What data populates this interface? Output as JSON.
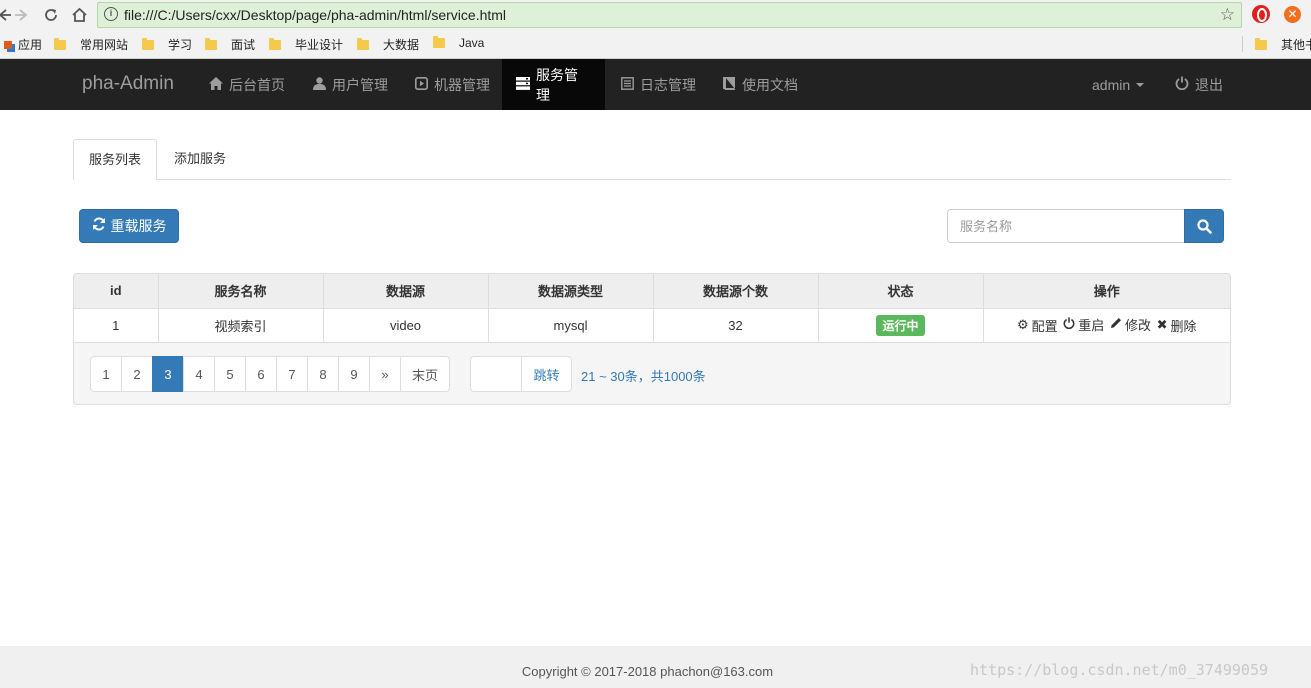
{
  "browser": {
    "url": "file:///C:/Users/cxx/Desktop/page/pha-admin/html/service.html",
    "bookmarks": [
      "应用",
      "常用网站",
      "学习",
      "面试",
      "毕业设计",
      "大数据",
      "Java",
      "其他书"
    ]
  },
  "navbar": {
    "brand": "pha-Admin",
    "items": [
      {
        "label": "后台首页",
        "icon": "home-icon"
      },
      {
        "label": "用户管理",
        "icon": "user-icon"
      },
      {
        "label": "机器管理",
        "icon": "play-square-icon"
      },
      {
        "label": "服务管理",
        "icon": "server-icon",
        "active": true
      },
      {
        "label": "日志管理",
        "icon": "list-alt-icon"
      },
      {
        "label": "使用文档",
        "icon": "book-icon"
      }
    ],
    "user": "admin",
    "logout": "退出"
  },
  "tabs": [
    {
      "label": "服务列表",
      "active": true
    },
    {
      "label": "添加服务",
      "active": false
    }
  ],
  "toolbar": {
    "reload_label": "重载服务",
    "search_placeholder": "服务名称"
  },
  "table": {
    "columns": [
      "id",
      "服务名称",
      "数据源",
      "数据源类型",
      "数据源个数",
      "状态",
      "操作"
    ],
    "rows": [
      {
        "id": "1",
        "name": "视频索引",
        "source": "video",
        "source_type": "mysql",
        "source_count": "32",
        "status": "运行中"
      }
    ],
    "actions": [
      "配置",
      "重启",
      "修改",
      "删除"
    ]
  },
  "pagination": {
    "pages": [
      "1",
      "2",
      "3",
      "4",
      "5",
      "6",
      "7",
      "8",
      "9"
    ],
    "current_page": 3,
    "next": "»",
    "last": "末页",
    "jump_label": "跳转",
    "info": "21 ~ 30条，共1000条"
  },
  "footer": {
    "copyright": "Copyright © 2017-2018  phachon@163.com",
    "watermark": "https://blog.csdn.net/m0_37499059"
  },
  "colors": {
    "primary": "#337ab7",
    "navbar": "#222222",
    "success": "#5cb85c"
  }
}
